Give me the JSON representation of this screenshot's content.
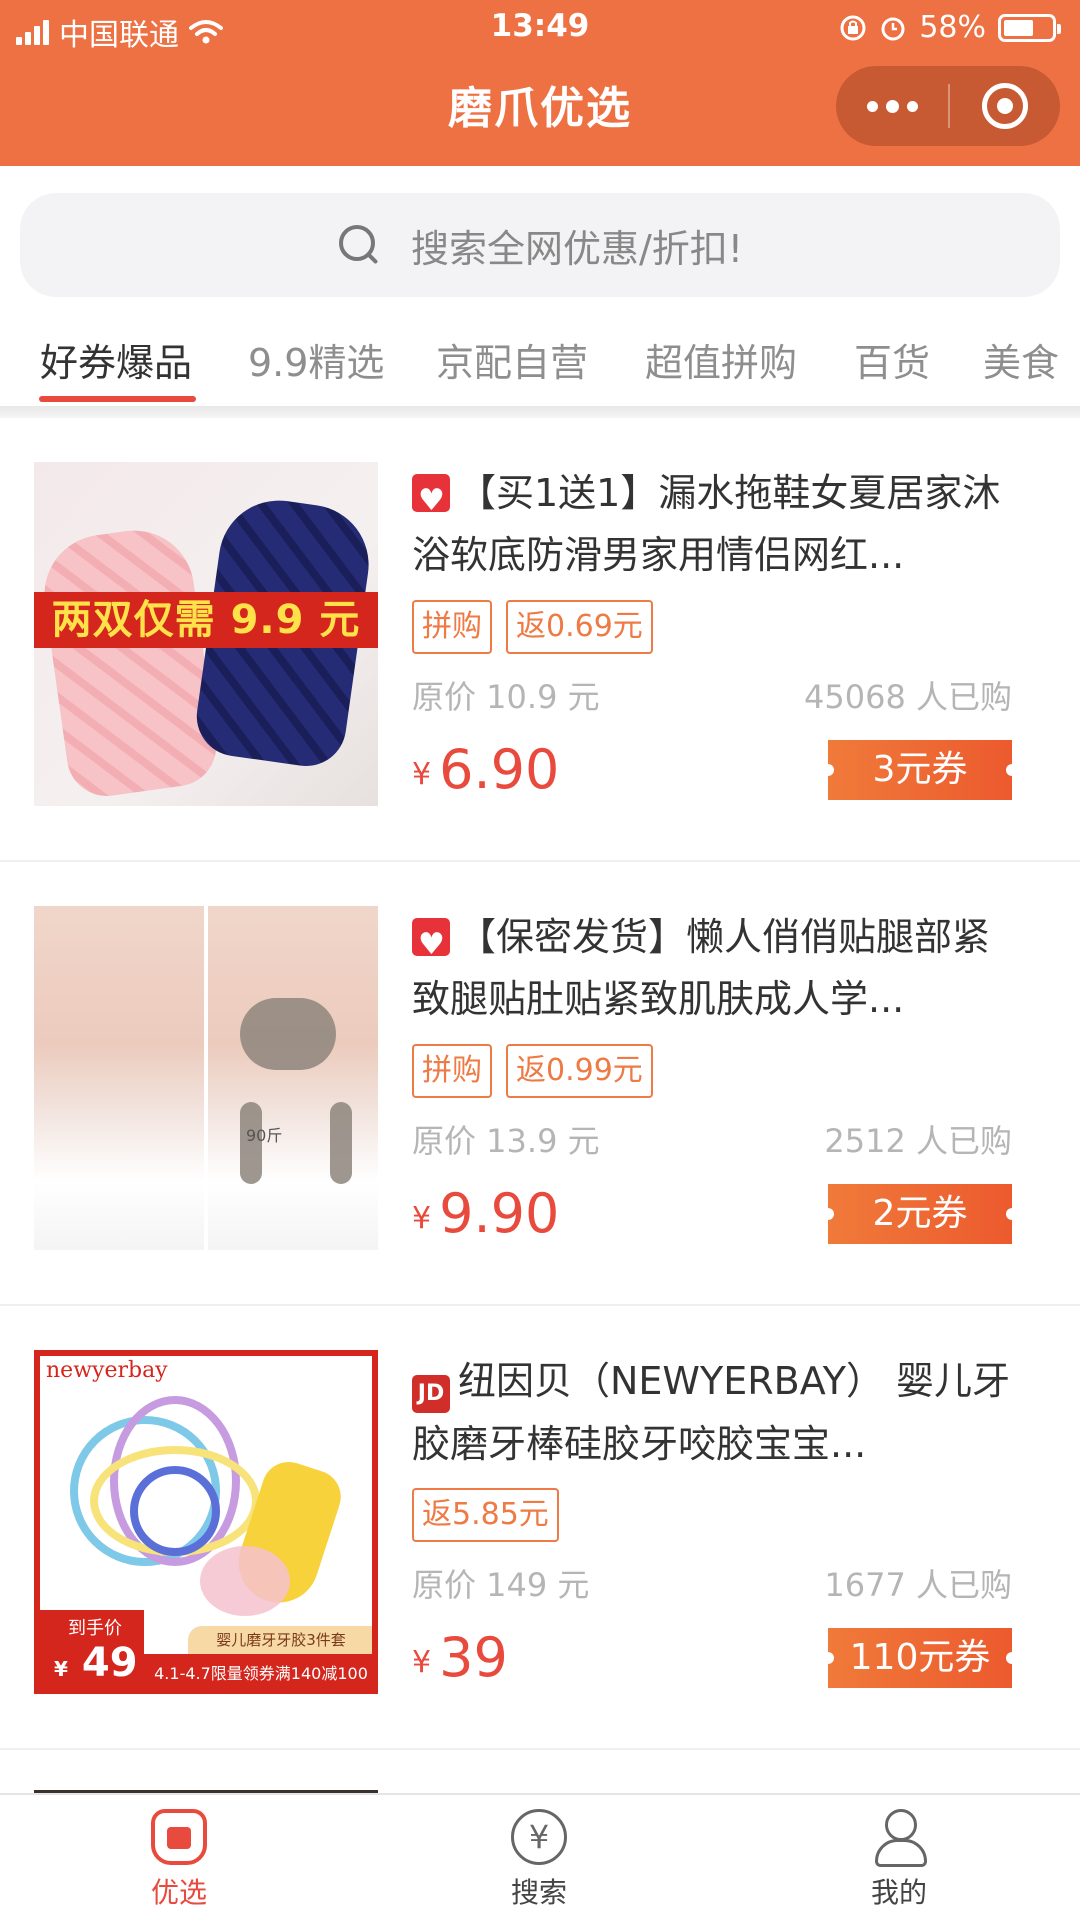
{
  "status": {
    "carrier": "中国联通",
    "time": "13:49",
    "battery": "58%"
  },
  "nav": {
    "title": "磨爪优选"
  },
  "search": {
    "placeholder": "搜索全网优惠/折扣!"
  },
  "tabs": [
    "好券爆品",
    "9.9精选",
    "京配自营",
    "超值拼购",
    "百货",
    "美食"
  ],
  "products": [
    {
      "source": "pinduoduo",
      "title": "【买1送1】漏水拖鞋女夏居家沐浴软底防滑男家用情侣网红...",
      "tags": [
        "拼购",
        "返0.69元"
      ],
      "original_price": "原价 10.9 元",
      "sold": "45068 人已购",
      "yen": "¥",
      "price": "6.90",
      "coupon": "3元券",
      "image_text": "两双仅需 9.9 元"
    },
    {
      "source": "pinduoduo",
      "title": "【保密发货】懒人俏俏贴腿部紧致腿贴肚贴紧致肌肤成人学...",
      "tags": [
        "拼购",
        "返0.99元"
      ],
      "original_price": "原价 13.9 元",
      "sold": "2512 人已购",
      "yen": "¥",
      "price": "9.90",
      "coupon": "2元券",
      "image_text": "90斤"
    },
    {
      "source": "jd",
      "source_label": "JD",
      "title": "纽因贝（NEWYERBAY） 婴儿牙胶磨牙棒硅胶牙咬胶宝宝...",
      "tags": [
        "返5.85元"
      ],
      "original_price": "原价 149 元",
      "sold": "1677 人已购",
      "yen": "¥",
      "price": "39",
      "coupon": "110元券",
      "image_brand": "newyerbay",
      "image_price_label": "到手价",
      "image_price": "49",
      "image_bundle": "婴儿磨牙牙胶3件套",
      "image_promo": "4.1-4.7限量领券满140减100"
    }
  ],
  "tabbar": {
    "items": [
      {
        "label": "优选",
        "icon": "home-icon"
      },
      {
        "label": "搜索",
        "icon": "yen-search-icon"
      },
      {
        "label": "我的",
        "icon": "user-icon"
      }
    ],
    "accent": "#e84a3d"
  },
  "colors": {
    "header_bg": "#ee7144",
    "price_red": "#e84a3d",
    "tag_orange": "#ee7a45"
  }
}
